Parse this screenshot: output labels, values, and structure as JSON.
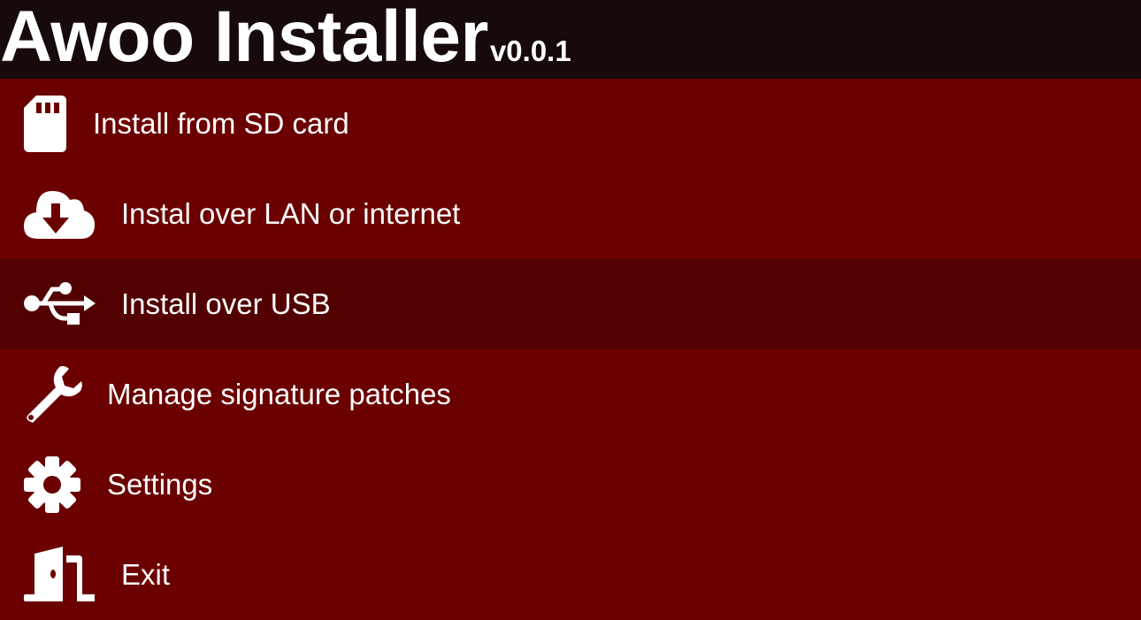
{
  "header": {
    "title": "Awoo Installer",
    "version": "v0.0.1"
  },
  "menu": {
    "items": [
      {
        "label": "Install from SD card",
        "icon": "sd-card-icon"
      },
      {
        "label": "Instal over LAN or internet",
        "icon": "cloud-download-icon"
      },
      {
        "label": "Install over USB",
        "icon": "usb-icon",
        "selected": true
      },
      {
        "label": "Manage signature patches",
        "icon": "wrench-icon"
      },
      {
        "label": "Settings",
        "icon": "gear-icon"
      },
      {
        "label": "Exit",
        "icon": "door-exit-icon"
      }
    ]
  },
  "colors": {
    "header_bg": "#160a0a",
    "menu_bg": "#6b0000",
    "menu_selected_bg": "#520000",
    "text": "#ffffff"
  }
}
